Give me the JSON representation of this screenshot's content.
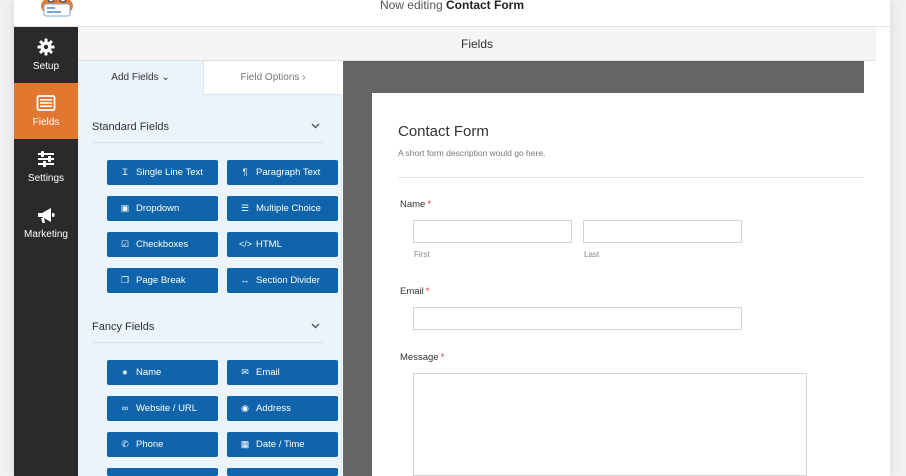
{
  "header": {
    "prefix": "Now editing",
    "form_name": "Contact Form"
  },
  "sidebar": {
    "items": [
      {
        "label": "Setup",
        "icon": "gear-icon"
      },
      {
        "label": "Fields",
        "icon": "fields-list-icon"
      },
      {
        "label": "Settings",
        "icon": "sliders-icon"
      },
      {
        "label": "Marketing",
        "icon": "megaphone-icon"
      }
    ],
    "active_color": "#e27730"
  },
  "main": {
    "section_title": "Fields"
  },
  "panel": {
    "tabs": [
      {
        "label": "Add Fields",
        "chevron": "⌄"
      },
      {
        "label": "Field Options",
        "chevron": "›"
      }
    ],
    "standard": {
      "title": "Standard Fields",
      "buttons": [
        {
          "label": "Single Line Text",
          "icon": "text-cursor-icon"
        },
        {
          "label": "Paragraph Text",
          "icon": "paragraph-icon"
        },
        {
          "label": "Dropdown",
          "icon": "dropdown-icon"
        },
        {
          "label": "Multiple Choice",
          "icon": "list-icon"
        },
        {
          "label": "Checkboxes",
          "icon": "checkbox-icon"
        },
        {
          "label": "HTML",
          "icon": "code-icon"
        },
        {
          "label": "Page Break",
          "icon": "copy-icon"
        },
        {
          "label": "Section Divider",
          "icon": "divider-icon"
        }
      ]
    },
    "fancy": {
      "title": "Fancy Fields",
      "buttons": [
        {
          "label": "Name",
          "icon": "user-icon"
        },
        {
          "label": "Email",
          "icon": "envelope-icon"
        },
        {
          "label": "Website / URL",
          "icon": "link-icon"
        },
        {
          "label": "Address",
          "icon": "map-pin-icon"
        },
        {
          "label": "Phone",
          "icon": "phone-icon"
        },
        {
          "label": "Date / Time",
          "icon": "calendar-icon"
        }
      ]
    },
    "button_color": "#0f64ac"
  },
  "form": {
    "title": "Contact Form",
    "description": "A short form description would go here.",
    "name_label": "Name",
    "first_label": "First",
    "last_label": "Last",
    "email_label": "Email",
    "message_label": "Message",
    "required_marker": "*"
  }
}
